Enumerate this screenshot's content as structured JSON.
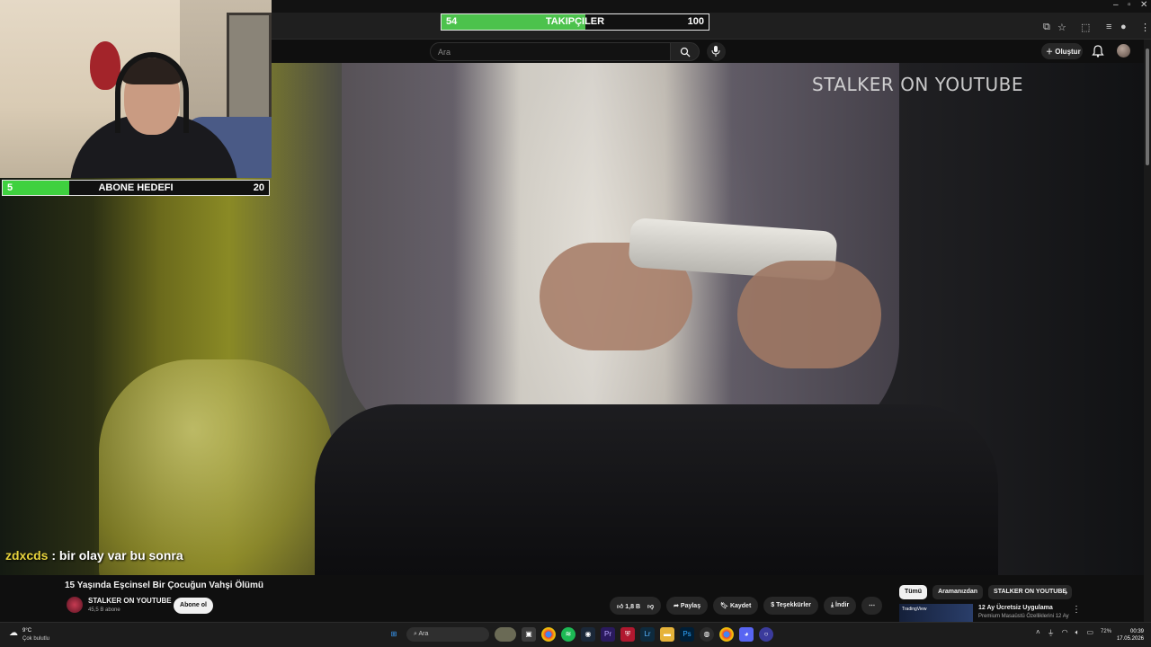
{
  "overlay": {
    "follower_goal": {
      "current": "54",
      "label": "TAKIPÇILER",
      "goal": "100",
      "progress": 0.54
    },
    "sub_goal": {
      "current": "5",
      "label": "ABONE HEDEFI",
      "goal": "20",
      "progress": 0.25
    },
    "chat": {
      "user": "zdxcds",
      "separator": " : ",
      "message": "bir olay var bu sonra"
    }
  },
  "youtube": {
    "search_placeholder": "Ara",
    "create_label": "Oluştur",
    "watermark": "STALKER ON YOUTUBE",
    "video_title": "15 Yaşında Eşcinsel Bir Çocuğun Vahşi Ölümü",
    "channel_name": "STALKER ON YOUTUBE",
    "channel_subs": "45,5 B abone",
    "subscribe_label": "Abone ol",
    "actions": {
      "likes": "1,8 B",
      "share": "Paylaş",
      "save": "Kaydet",
      "thanks": "Teşekkürler",
      "download": "İndir"
    },
    "chips": [
      "Tümü",
      "Aramanızdan",
      "STALKER ON YOUTUBE"
    ],
    "recommendation": {
      "thumb_text": "TradingView",
      "title": "12 Ay Ücretsiz Uygulama",
      "subtitle": "Premium Masaüstü Özelliklerini 12 Ay"
    }
  },
  "taskbar": {
    "weather_temp": "9°C",
    "weather_condition": "Çok bulutlu",
    "search_placeholder": "Ara",
    "battery": "72%",
    "time": "00:39",
    "date": "17.05.2026"
  },
  "colors": {
    "progress_green": "#4cc24c",
    "chat_user": "#e6d23c",
    "bg": "#0f0f0f"
  }
}
